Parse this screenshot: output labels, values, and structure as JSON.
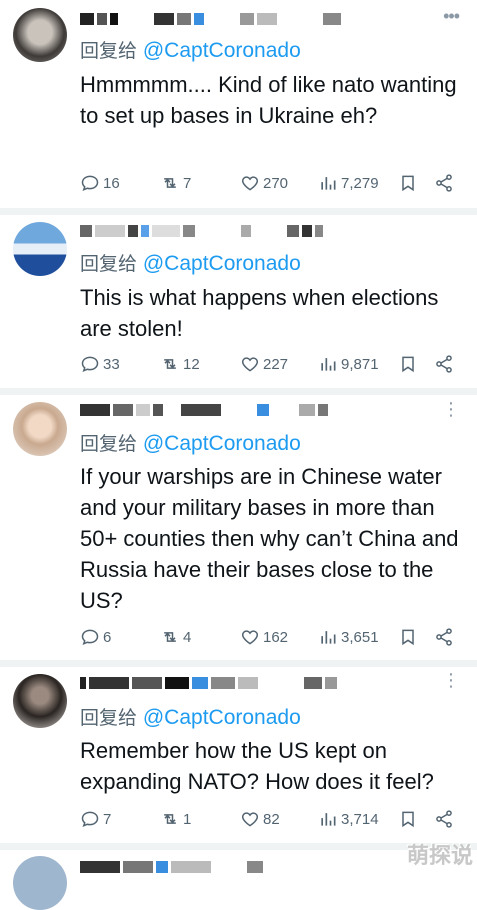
{
  "reply_prefix": "回复给",
  "tweets": [
    {
      "handle": "@CaptCoronado",
      "text": "Hmmmmm.... Kind of like nato wanting to set up bases in Ukraine eh?",
      "replies": "16",
      "retweets": "7",
      "likes": "270",
      "views": "7,279"
    },
    {
      "handle": "@CaptCoronado",
      "text": "This is what happens when elections are stolen!",
      "replies": "33",
      "retweets": "12",
      "likes": "227",
      "views": "9,871"
    },
    {
      "handle": "@CaptCoronado",
      "text": "If your warships are in Chinese water and your military bases in more than 50+ counties then why can’t China and Russia have their bases close to the US?",
      "replies": "6",
      "retweets": "4",
      "likes": "162",
      "views": "3,651"
    },
    {
      "handle": "@CaptCoronado",
      "text": "Remember how the US kept on expanding NATO? How does it feel?",
      "replies": "7",
      "retweets": "1",
      "likes": "82",
      "views": "3,714"
    }
  ],
  "watermark": "萌探说",
  "colors": {
    "accent": "#1d9bf0",
    "muted": "#536471",
    "text": "#0f1419",
    "divider": "#eff3f4"
  },
  "icons": [
    "reply-icon",
    "retweet-icon",
    "like-icon",
    "views-icon",
    "bookmark-icon",
    "share-icon",
    "more-icon"
  ]
}
